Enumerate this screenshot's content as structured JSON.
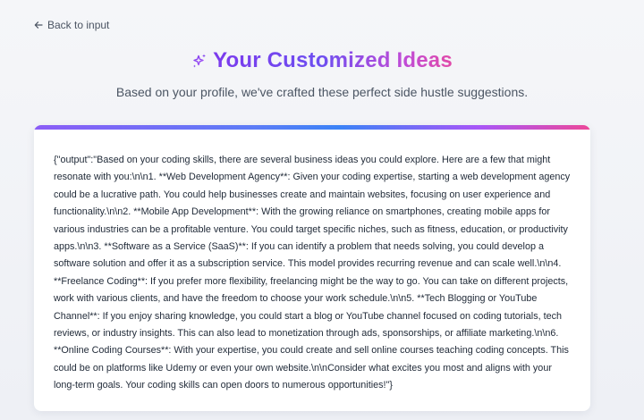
{
  "nav": {
    "back_label": "Back to input",
    "back_icon": "arrow-left-icon"
  },
  "header": {
    "title": "Your Customized Ideas",
    "title_icon": "sparkle-icon",
    "subtitle": "Based on your profile, we've crafted these perfect side hustle suggestions."
  },
  "result": {
    "text": "{\"output\":\"Based on your coding skills, there are several business ideas you could explore. Here are a few that might resonate with you:\\n\\n1. **Web Development Agency**: Given your coding expertise, starting a web development agency could be a lucrative path. You could help businesses create and maintain websites, focusing on user experience and functionality.\\n\\n2. **Mobile App Development**: With the growing reliance on smartphones, creating mobile apps for various industries can be a profitable venture. You could target specific niches, such as fitness, education, or productivity apps.\\n\\n3. **Software as a Service (SaaS)**: If you can identify a problem that needs solving, you could develop a software solution and offer it as a subscription service. This model provides recurring revenue and can scale well.\\n\\n4. **Freelance Coding**: If you prefer more flexibility, freelancing might be the way to go. You can take on different projects, work with various clients, and have the freedom to choose your work schedule.\\n\\n5. **Tech Blogging or YouTube Channel**: If you enjoy sharing knowledge, you could start a blog or YouTube channel focused on coding tutorials, tech reviews, or industry insights. This can also lead to monetization through ads, sponsorships, or affiliate marketing.\\n\\n6. **Online Coding Courses**: With your expertise, you could create and sell online courses teaching coding concepts. This could be on platforms like Udemy or even your own website.\\n\\nConsider what excites you most and aligns with your long-term goals. Your coding skills can open doors to numerous opportunities!\"}"
  },
  "colors": {
    "title_gradient_start": "#7c3aed",
    "title_gradient_end": "#e24aa8",
    "bar_gradient_start": "#8b5cf6",
    "bar_gradient_mid": "#3b82f6",
    "bar_gradient_end": "#ec4899"
  }
}
